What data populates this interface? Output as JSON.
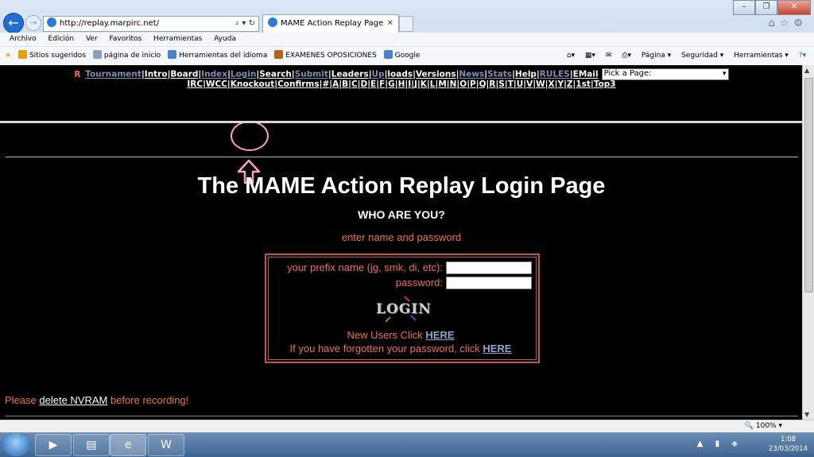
{
  "browser": {
    "url": "http://replay.marpirc.net/",
    "tab_title": "MAME Action Replay Page",
    "menu": [
      "Archivo",
      "Edición",
      "Ver",
      "Favoritos",
      "Herramientas",
      "Ayuda"
    ],
    "favorites": [
      "Sitios sugeridos",
      "página de inicio",
      "Herramientas del idioma",
      "EXAMENES OPOSICIONES",
      "Google"
    ],
    "commands": [
      "Página ▾",
      "Seguridad ▾",
      "Herramientas ▾"
    ],
    "zoom": "100%"
  },
  "site_nav": {
    "prefix": "R",
    "row1": [
      {
        "label": "Tournament",
        "alt": true
      },
      {
        "label": "Intro",
        "alt": false
      },
      {
        "label": "Board",
        "alt": false
      },
      {
        "label": "Index",
        "alt": true
      },
      {
        "label": "Login",
        "alt": true
      },
      {
        "label": "Search",
        "alt": false
      },
      {
        "label": "Submit",
        "alt": true
      },
      {
        "label": "Leaders",
        "alt": false
      },
      {
        "label": "Up",
        "alt": true
      },
      {
        "label": "loads",
        "alt": false
      },
      {
        "label": "Versions",
        "alt": false
      },
      {
        "label": "News",
        "alt": true
      },
      {
        "label": "Stats",
        "alt": true
      },
      {
        "label": "Help",
        "alt": false
      },
      {
        "label": "RULES",
        "alt": true
      },
      {
        "label": "EMail",
        "alt": false
      }
    ],
    "pick_page": "Pick a Page:",
    "row2": [
      "IRC",
      "WCC",
      "Knockout",
      "Confirms",
      "#",
      "A",
      "B",
      "C",
      "D",
      "E",
      "F",
      "G",
      "H",
      "I",
      "J",
      "K",
      "L",
      "M",
      "N",
      "O",
      "P",
      "Q",
      "R",
      "S",
      "T",
      "U",
      "V",
      "W",
      "X",
      "Y",
      "Z",
      "1st",
      "Top3"
    ]
  },
  "main": {
    "title": "The MAME Action Replay Login Page",
    "who": "WHO ARE YOU?",
    "instruction": "enter name and password",
    "prefix_label": "your prefix name (jg, smk, di, etc):",
    "password_label": "password:",
    "login_button": "LOGIN",
    "new_users_text": "New Users Click",
    "new_users_link": "HERE",
    "forgot_text": "If you have forgotten your password, click",
    "forgot_link": "HERE",
    "please_prefix": "Please",
    "please_link": "delete NVRAM",
    "please_suffix": "before recording!"
  },
  "taskbar": {
    "time": "1:08",
    "date": "23/03/2014"
  }
}
